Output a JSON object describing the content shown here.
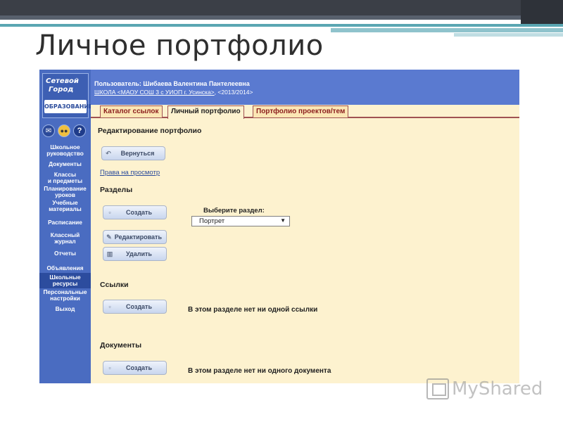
{
  "slide": {
    "title": "Личное портфолио"
  },
  "app": {
    "logo": {
      "line1": "Сетевой",
      "line2": "Город",
      "ribbon": "ОБРАЗОВАНИЕ"
    },
    "header": {
      "user": "Пользователь: Шибаева Валентина Пантелеевна",
      "school_link": "ШКОЛА <МАОУ СОШ 3 с УИОП г. Усинска>",
      "year": ", <2013/2014>"
    },
    "sidebar": {
      "icons": [
        "mail-icon",
        "users-icon",
        "help-icon"
      ],
      "items": [
        {
          "label_1": "Школьное",
          "label_2": "руководство"
        },
        {
          "label_1": "Документы",
          "label_2": ""
        },
        {
          "label_1": "Классы",
          "label_2": "и предметы"
        },
        {
          "label_1": "Планирование",
          "label_2": "уроков"
        },
        {
          "label_1": "Учебные",
          "label_2": "материалы"
        },
        {
          "label_1": "Расписание",
          "label_2": ""
        },
        {
          "label_1": "Классный",
          "label_2": "журнал"
        },
        {
          "label_1": "Отчеты",
          "label_2": ""
        },
        {
          "label_1": "Объявления",
          "label_2": ""
        },
        {
          "label_1": "Школьные",
          "label_2": "ресурсы",
          "active": true
        },
        {
          "label_1": "Персональные",
          "label_2": "настройки"
        },
        {
          "label_1": "Выход",
          "label_2": ""
        }
      ]
    },
    "tabs": [
      {
        "label": "Каталог ссылок",
        "active": false
      },
      {
        "label": "Личный портфолио",
        "active": true
      },
      {
        "label": "Портфолио проектов/тем",
        "active": false
      }
    ],
    "content": {
      "heading": "Редактирование портфолио",
      "back_button": "Вернуться",
      "rights_link": "Права на просмотр",
      "sections": {
        "title": "Разделы",
        "create_button": "Создать",
        "edit_button": "Редактировать",
        "delete_button": "Удалить",
        "select_label": "Выберите раздел:",
        "select_value": "Портрет"
      },
      "links": {
        "title": "Ссылки",
        "create_button": "Создать",
        "empty_note": "В этом разделе нет ни одной ссылки"
      },
      "documents": {
        "title": "Документы",
        "create_button": "Создать",
        "empty_note": "В этом разделе нет ни одного документа"
      }
    }
  },
  "watermark": {
    "text": "MyShared"
  },
  "colors": {
    "sidebar": "#4a6cc1",
    "header": "#5a7ad0",
    "content_bg": "#fdf2cf",
    "tab_text": "#8b1d1d",
    "link": "#2a4b9b"
  }
}
